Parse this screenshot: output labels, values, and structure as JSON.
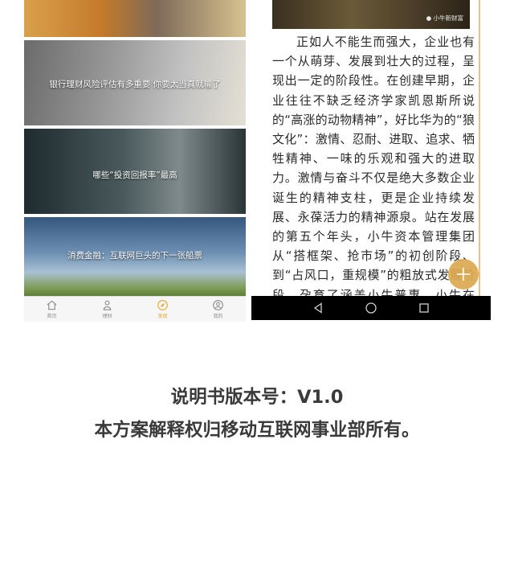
{
  "left_screen": {
    "cards": [
      {
        "title": ""
      },
      {
        "title": "银行理财风险评估有多重要  你要太当真就输了"
      },
      {
        "title": "哪些“投资回报率”最高"
      },
      {
        "title": "消费金融：互联网巨头的下一张船票"
      }
    ],
    "tabbar": [
      {
        "label": "首页",
        "icon": "home-icon"
      },
      {
        "label": "理财",
        "icon": "wallet-icon"
      },
      {
        "label": "发现",
        "icon": "compass-icon"
      },
      {
        "label": "我的",
        "icon": "user-icon"
      }
    ],
    "accent_color": "#e3a92b"
  },
  "right_screen": {
    "image_watermark": "小牛新财富",
    "article_body": "正如人不能生而强大，企业也有一个从萌芽、发展到壮大的过程，呈现出一定的阶段性。在创建早期，企业往往不缺乏经济学家凯恩斯所说的“高涨的动物精神”，好比华为的“狼文化”：激情、忍耐、进取、追求、牺牲精神、一味的乐观和强大的进取力。激情与奋斗不仅是绝大多数企业诞生的精神支柱，更是企业持续发展、永葆活力的精神源泉。站在发展的第五个年头，小牛资本管理集团从“搭框架、抢市场”的初创阶段、到“占风口，重规模”的粗放式发展阶段，孕育了涵盖小牛普惠、小牛在线、小牛分",
    "fab_icon": "plus-icon",
    "fab_color": "#dba84e",
    "nav_buttons": [
      "back-icon",
      "home-circle-icon",
      "recents-icon"
    ]
  },
  "caption": {
    "line1": "说明书版本号：V1.0",
    "line2": "本方案解释权归移动互联网事业部所有。"
  }
}
